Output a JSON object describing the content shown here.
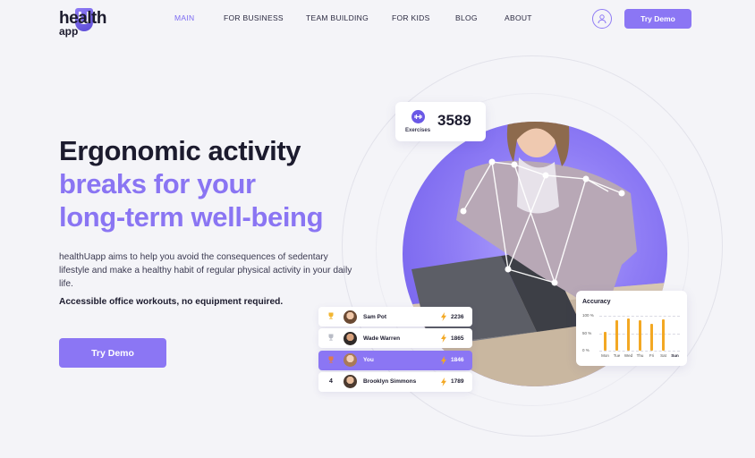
{
  "logo": {
    "top": "health",
    "letter": "U",
    "bottom": "app"
  },
  "nav": {
    "items": [
      {
        "label": "MAIN",
        "active": true
      },
      {
        "label": "FOR BUSINESS",
        "active": false
      },
      {
        "label": "TEAM BUILDING",
        "active": false
      },
      {
        "label": "FOR KIDS",
        "active": false
      },
      {
        "label": "BLOG",
        "active": false
      },
      {
        "label": "ABOUT",
        "active": false
      }
    ],
    "user_icon": "user-icon",
    "cta_label": "Try Demo"
  },
  "hero": {
    "heading_line1": "Ergonomic activity",
    "heading_line2": "breaks for your",
    "heading_line3": "long-term well-being",
    "description": "healthUapp aims to help you avoid the consequences of sedentary lifestyle and make a healthy habit of regular physical activity in your daily life.",
    "description_strong": "Accessible office workouts, no equipment required.",
    "cta_label": "Try Demo"
  },
  "exercises_card": {
    "label": "Exercises",
    "value": "3589",
    "icon": "dumbbell-icon"
  },
  "leaderboard": [
    {
      "rank_icon": "gold-trophy-icon",
      "rank": "",
      "name": "Sam Pot",
      "score": "2236",
      "highlight": false
    },
    {
      "rank_icon": "silver-trophy-icon",
      "rank": "",
      "name": "Wade Warren",
      "score": "1865",
      "highlight": false
    },
    {
      "rank_icon": "bronze-trophy-icon",
      "rank": "",
      "name": "You",
      "score": "1846",
      "highlight": true
    },
    {
      "rank_icon": "",
      "rank": "4",
      "name": "Brooklyn Simmons",
      "score": "1789",
      "highlight": false
    }
  ],
  "accuracy_card": {
    "title": "Accuracy",
    "y_labels": [
      "100 %",
      "50 %",
      "0 %"
    ],
    "days": [
      "Mon",
      "Tue",
      "Wed",
      "Thu",
      "Fri",
      "Sat",
      "Sun"
    ],
    "values": [
      55,
      88,
      92,
      86,
      78,
      90,
      0
    ],
    "bold_day": "Sun",
    "bar_color": "#f3a823"
  },
  "colors": {
    "accent": "#8b76f4",
    "dark": "#1c1b2e",
    "background": "#f4f4f8"
  }
}
